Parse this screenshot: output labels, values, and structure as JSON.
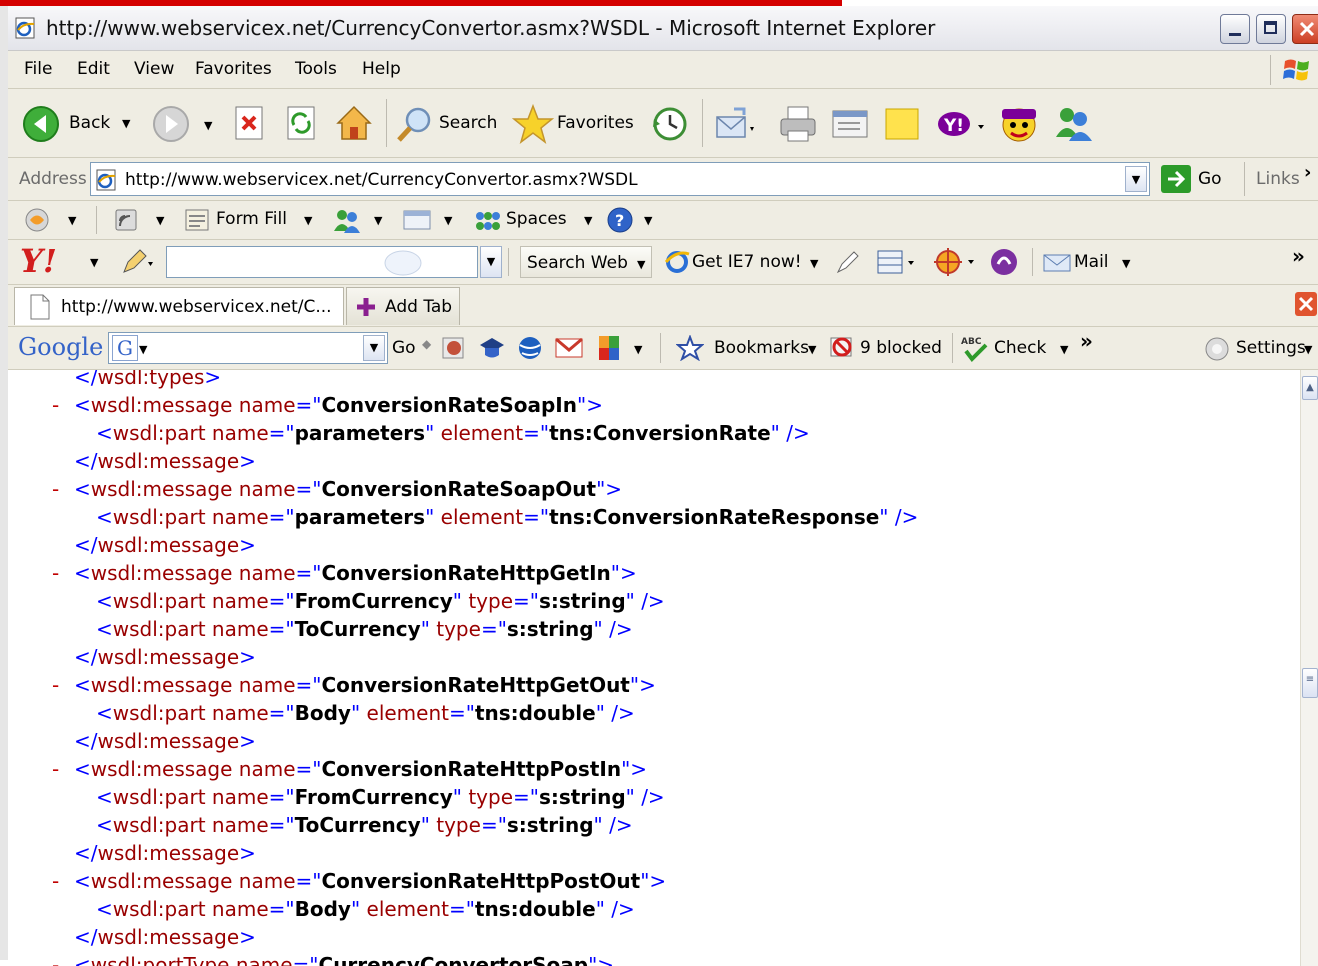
{
  "window": {
    "title": "http://www.webservicex.net/CurrencyConvertor.asmx?WSDL - Microsoft Internet Explorer"
  },
  "menu": [
    "File",
    "Edit",
    "View",
    "Favorites",
    "Tools",
    "Help"
  ],
  "toolbar": {
    "back_label": "Back",
    "search_label": "Search",
    "favorites_label": "Favorites"
  },
  "address": {
    "label": "Address",
    "url": "http://www.webservicex.net/CurrencyConvertor.asmx?WSDL",
    "go_label": "Go",
    "links_label": "Links"
  },
  "links_toolbar": {
    "form_fill_label": "Form Fill",
    "spaces_label": "Spaces"
  },
  "yahoo_toolbar": {
    "logo": "Y!",
    "search_web_label": "Search Web",
    "get_ie7_label": "Get IE7 now!",
    "mail_label": "Mail",
    "more_label": "»"
  },
  "tabs": {
    "active_tab_label": "http://www.webservicex.net/C...",
    "add_tab_label": "Add Tab"
  },
  "google_toolbar": {
    "logo": "Google",
    "go_label": "Go",
    "bookmarks_label": "Bookmarks",
    "blocked_label": "9 blocked",
    "check_label": "Check",
    "more_label": "»",
    "settings_label": "Settings"
  },
  "colors": {
    "tag": "#990000",
    "markup": "#0000ff",
    "attr_value": "#000000",
    "collapse_minus": "#c00000",
    "title_bar_red": "#d40000"
  },
  "xml_lines": [
    {
      "minus": "",
      "indent": 1,
      "parts": [
        {
          "c": "b",
          "t": "</"
        },
        {
          "c": "t",
          "t": "wsdl:types"
        },
        {
          "c": "b",
          "t": ">"
        }
      ]
    },
    {
      "minus": "-",
      "indent": 1,
      "parts": [
        {
          "c": "b",
          "t": "<"
        },
        {
          "c": "t",
          "t": "wsdl:message"
        },
        {
          "c": "an",
          "t": " name"
        },
        {
          "c": "b",
          "t": "=\""
        },
        {
          "c": "v",
          "t": "ConversionRateSoapIn"
        },
        {
          "c": "b",
          "t": "\">"
        }
      ]
    },
    {
      "minus": "",
      "indent": 2,
      "parts": [
        {
          "c": "b",
          "t": "<"
        },
        {
          "c": "t",
          "t": "wsdl:part"
        },
        {
          "c": "an",
          "t": " name"
        },
        {
          "c": "b",
          "t": "=\""
        },
        {
          "c": "v",
          "t": "parameters"
        },
        {
          "c": "b",
          "t": "\""
        },
        {
          "c": "an",
          "t": " element"
        },
        {
          "c": "b",
          "t": "=\""
        },
        {
          "c": "v",
          "t": "tns:ConversionRate"
        },
        {
          "c": "b",
          "t": "\" />"
        }
      ]
    },
    {
      "minus": "",
      "indent": 1,
      "parts": [
        {
          "c": "b",
          "t": "</"
        },
        {
          "c": "t",
          "t": "wsdl:message"
        },
        {
          "c": "b",
          "t": ">"
        }
      ]
    },
    {
      "minus": "-",
      "indent": 1,
      "parts": [
        {
          "c": "b",
          "t": "<"
        },
        {
          "c": "t",
          "t": "wsdl:message"
        },
        {
          "c": "an",
          "t": " name"
        },
        {
          "c": "b",
          "t": "=\""
        },
        {
          "c": "v",
          "t": "ConversionRateSoapOut"
        },
        {
          "c": "b",
          "t": "\">"
        }
      ]
    },
    {
      "minus": "",
      "indent": 2,
      "parts": [
        {
          "c": "b",
          "t": "<"
        },
        {
          "c": "t",
          "t": "wsdl:part"
        },
        {
          "c": "an",
          "t": " name"
        },
        {
          "c": "b",
          "t": "=\""
        },
        {
          "c": "v",
          "t": "parameters"
        },
        {
          "c": "b",
          "t": "\""
        },
        {
          "c": "an",
          "t": " element"
        },
        {
          "c": "b",
          "t": "=\""
        },
        {
          "c": "v",
          "t": "tns:ConversionRateResponse"
        },
        {
          "c": "b",
          "t": "\" />"
        }
      ]
    },
    {
      "minus": "",
      "indent": 1,
      "parts": [
        {
          "c": "b",
          "t": "</"
        },
        {
          "c": "t",
          "t": "wsdl:message"
        },
        {
          "c": "b",
          "t": ">"
        }
      ]
    },
    {
      "minus": "-",
      "indent": 1,
      "parts": [
        {
          "c": "b",
          "t": "<"
        },
        {
          "c": "t",
          "t": "wsdl:message"
        },
        {
          "c": "an",
          "t": " name"
        },
        {
          "c": "b",
          "t": "=\""
        },
        {
          "c": "v",
          "t": "ConversionRateHttpGetIn"
        },
        {
          "c": "b",
          "t": "\">"
        }
      ]
    },
    {
      "minus": "",
      "indent": 2,
      "parts": [
        {
          "c": "b",
          "t": "<"
        },
        {
          "c": "t",
          "t": "wsdl:part"
        },
        {
          "c": "an",
          "t": " name"
        },
        {
          "c": "b",
          "t": "=\""
        },
        {
          "c": "v",
          "t": "FromCurrency"
        },
        {
          "c": "b",
          "t": "\""
        },
        {
          "c": "an",
          "t": " type"
        },
        {
          "c": "b",
          "t": "=\""
        },
        {
          "c": "v",
          "t": "s:string"
        },
        {
          "c": "b",
          "t": "\" />"
        }
      ]
    },
    {
      "minus": "",
      "indent": 2,
      "parts": [
        {
          "c": "b",
          "t": "<"
        },
        {
          "c": "t",
          "t": "wsdl:part"
        },
        {
          "c": "an",
          "t": " name"
        },
        {
          "c": "b",
          "t": "=\""
        },
        {
          "c": "v",
          "t": "ToCurrency"
        },
        {
          "c": "b",
          "t": "\""
        },
        {
          "c": "an",
          "t": " type"
        },
        {
          "c": "b",
          "t": "=\""
        },
        {
          "c": "v",
          "t": "s:string"
        },
        {
          "c": "b",
          "t": "\" />"
        }
      ]
    },
    {
      "minus": "",
      "indent": 1,
      "parts": [
        {
          "c": "b",
          "t": "</"
        },
        {
          "c": "t",
          "t": "wsdl:message"
        },
        {
          "c": "b",
          "t": ">"
        }
      ]
    },
    {
      "minus": "-",
      "indent": 1,
      "parts": [
        {
          "c": "b",
          "t": "<"
        },
        {
          "c": "t",
          "t": "wsdl:message"
        },
        {
          "c": "an",
          "t": " name"
        },
        {
          "c": "b",
          "t": "=\""
        },
        {
          "c": "v",
          "t": "ConversionRateHttpGetOut"
        },
        {
          "c": "b",
          "t": "\">"
        }
      ]
    },
    {
      "minus": "",
      "indent": 2,
      "parts": [
        {
          "c": "b",
          "t": "<"
        },
        {
          "c": "t",
          "t": "wsdl:part"
        },
        {
          "c": "an",
          "t": " name"
        },
        {
          "c": "b",
          "t": "=\""
        },
        {
          "c": "v",
          "t": "Body"
        },
        {
          "c": "b",
          "t": "\""
        },
        {
          "c": "an",
          "t": " element"
        },
        {
          "c": "b",
          "t": "=\""
        },
        {
          "c": "v",
          "t": "tns:double"
        },
        {
          "c": "b",
          "t": "\" />"
        }
      ]
    },
    {
      "minus": "",
      "indent": 1,
      "parts": [
        {
          "c": "b",
          "t": "</"
        },
        {
          "c": "t",
          "t": "wsdl:message"
        },
        {
          "c": "b",
          "t": ">"
        }
      ]
    },
    {
      "minus": "-",
      "indent": 1,
      "parts": [
        {
          "c": "b",
          "t": "<"
        },
        {
          "c": "t",
          "t": "wsdl:message"
        },
        {
          "c": "an",
          "t": " name"
        },
        {
          "c": "b",
          "t": "=\""
        },
        {
          "c": "v",
          "t": "ConversionRateHttpPostIn"
        },
        {
          "c": "b",
          "t": "\">"
        }
      ]
    },
    {
      "minus": "",
      "indent": 2,
      "parts": [
        {
          "c": "b",
          "t": "<"
        },
        {
          "c": "t",
          "t": "wsdl:part"
        },
        {
          "c": "an",
          "t": " name"
        },
        {
          "c": "b",
          "t": "=\""
        },
        {
          "c": "v",
          "t": "FromCurrency"
        },
        {
          "c": "b",
          "t": "\""
        },
        {
          "c": "an",
          "t": " type"
        },
        {
          "c": "b",
          "t": "=\""
        },
        {
          "c": "v",
          "t": "s:string"
        },
        {
          "c": "b",
          "t": "\" />"
        }
      ]
    },
    {
      "minus": "",
      "indent": 2,
      "parts": [
        {
          "c": "b",
          "t": "<"
        },
        {
          "c": "t",
          "t": "wsdl:part"
        },
        {
          "c": "an",
          "t": " name"
        },
        {
          "c": "b",
          "t": "=\""
        },
        {
          "c": "v",
          "t": "ToCurrency"
        },
        {
          "c": "b",
          "t": "\""
        },
        {
          "c": "an",
          "t": " type"
        },
        {
          "c": "b",
          "t": "=\""
        },
        {
          "c": "v",
          "t": "s:string"
        },
        {
          "c": "b",
          "t": "\" />"
        }
      ]
    },
    {
      "minus": "",
      "indent": 1,
      "parts": [
        {
          "c": "b",
          "t": "</"
        },
        {
          "c": "t",
          "t": "wsdl:message"
        },
        {
          "c": "b",
          "t": ">"
        }
      ]
    },
    {
      "minus": "-",
      "indent": 1,
      "parts": [
        {
          "c": "b",
          "t": "<"
        },
        {
          "c": "t",
          "t": "wsdl:message"
        },
        {
          "c": "an",
          "t": " name"
        },
        {
          "c": "b",
          "t": "=\""
        },
        {
          "c": "v",
          "t": "ConversionRateHttpPostOut"
        },
        {
          "c": "b",
          "t": "\">"
        }
      ]
    },
    {
      "minus": "",
      "indent": 2,
      "parts": [
        {
          "c": "b",
          "t": "<"
        },
        {
          "c": "t",
          "t": "wsdl:part"
        },
        {
          "c": "an",
          "t": " name"
        },
        {
          "c": "b",
          "t": "=\""
        },
        {
          "c": "v",
          "t": "Body"
        },
        {
          "c": "b",
          "t": "\""
        },
        {
          "c": "an",
          "t": " element"
        },
        {
          "c": "b",
          "t": "=\""
        },
        {
          "c": "v",
          "t": "tns:double"
        },
        {
          "c": "b",
          "t": "\" />"
        }
      ]
    },
    {
      "minus": "",
      "indent": 1,
      "parts": [
        {
          "c": "b",
          "t": "</"
        },
        {
          "c": "t",
          "t": "wsdl:message"
        },
        {
          "c": "b",
          "t": ">"
        }
      ]
    },
    {
      "minus": "-",
      "indent": 1,
      "parts": [
        {
          "c": "b",
          "t": "<"
        },
        {
          "c": "t",
          "t": "wsdl:portType"
        },
        {
          "c": "an",
          "t": " name"
        },
        {
          "c": "b",
          "t": "=\""
        },
        {
          "c": "v",
          "t": "CurrencyConvertorSoap"
        },
        {
          "c": "b",
          "t": "\">"
        }
      ]
    }
  ]
}
